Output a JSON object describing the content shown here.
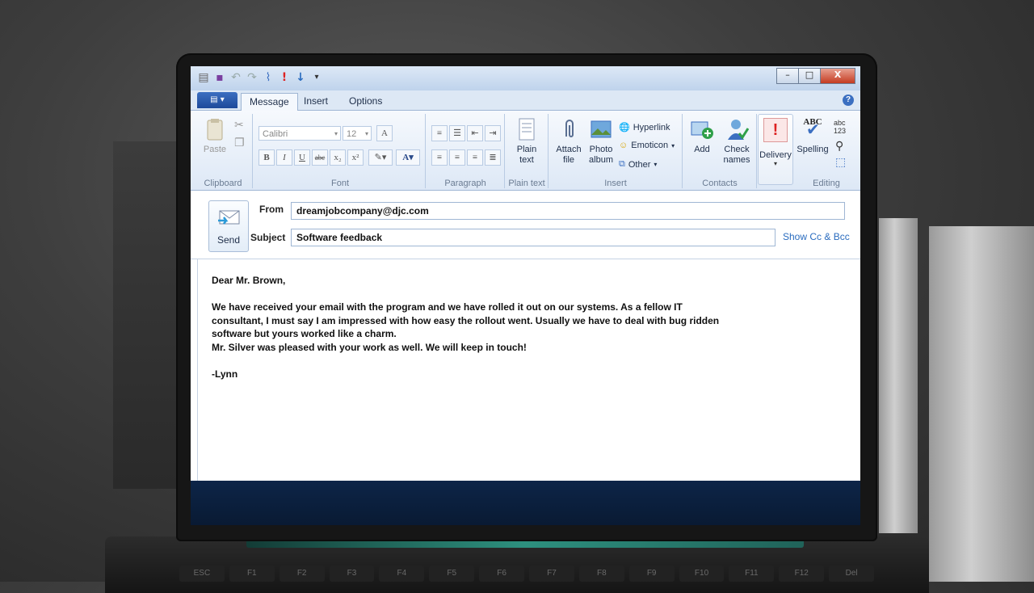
{
  "colors": {
    "ribbon_bg": "#dde8f5",
    "accent": "#2a6cbf",
    "close": "#c43b21"
  },
  "window": {
    "controls": {
      "minimize": "–",
      "maximize": "□",
      "close": "X"
    }
  },
  "tabs": [
    {
      "label": "Message",
      "active": true
    },
    {
      "label": "Insert",
      "active": false
    },
    {
      "label": "Options",
      "active": false
    }
  ],
  "ribbon": {
    "clipboard": {
      "group_label": "Clipboard",
      "paste_label": "Paste"
    },
    "font": {
      "group_label": "Font",
      "font_name": "Calibri",
      "font_size": "12"
    },
    "paragraph": {
      "group_label": "Paragraph"
    },
    "plain_text": {
      "group_label": "Plain text",
      "button_line1": "Plain",
      "button_line2": "text"
    },
    "insert": {
      "group_label": "Insert",
      "attach_line1": "Attach",
      "attach_line2": "file",
      "photo_line1": "Photo",
      "photo_line2": "album",
      "hyperlink": "Hyperlink",
      "emoticon": "Emoticon",
      "other": "Other"
    },
    "contacts": {
      "group_label": "Contacts",
      "add": "Add",
      "check_line1": "Check",
      "check_line2": "names"
    },
    "delivery": {
      "label": "Delivery"
    },
    "editing": {
      "group_label": "Editing",
      "spelling": "Spelling",
      "abc": "ABC"
    }
  },
  "compose": {
    "send_label": "Send",
    "from_label": "From",
    "from_value": "dreamjobcompany@djc.com",
    "subject_label": "Subject",
    "subject_value": "Software feedback",
    "show_cc_bcc": "Show Cc & Bcc"
  },
  "message_body": {
    "greeting": "Dear Mr. Brown,",
    "para1": "We have received your email with the program and we have rolled it out on our systems. As a fellow IT consultant, I must say I am impressed with how easy the rollout went. Usually we have to deal with bug ridden software but yours worked like a charm.",
    "para2": "Mr. Silver was pleased with your work as well. We will keep in touch!",
    "signature": "-Lynn"
  },
  "keyboard": {
    "keys": [
      "ESC",
      "F1",
      "F2",
      "F3",
      "F4",
      "F5",
      "F6",
      "F7",
      "F8",
      "F9",
      "F10",
      "F11",
      "F12",
      "Del"
    ]
  }
}
